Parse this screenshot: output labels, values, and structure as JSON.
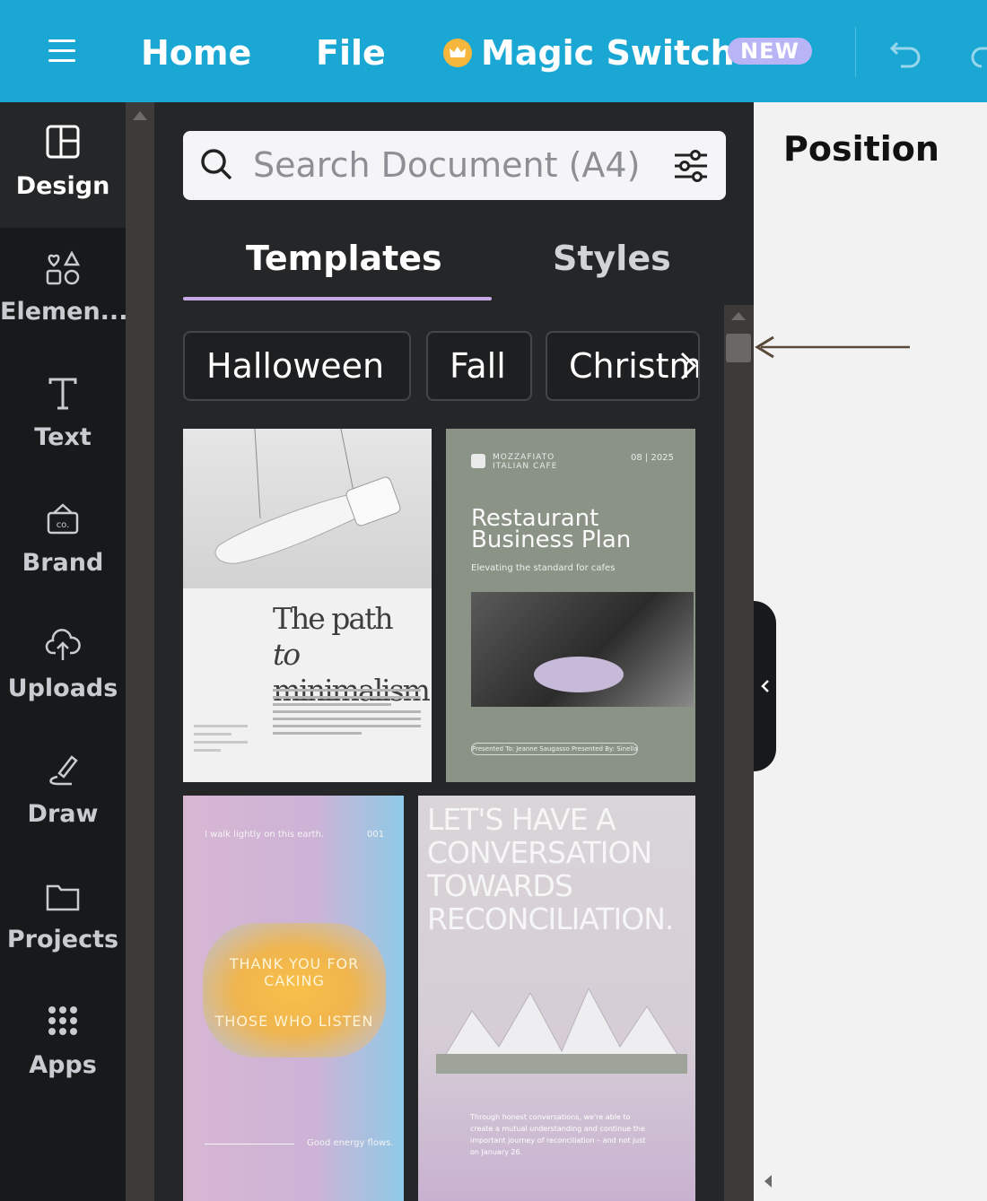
{
  "topbar": {
    "home": "Home",
    "file": "File",
    "magic_switch": "Magic Switch",
    "new_badge": "NEW"
  },
  "sidebar": {
    "items": [
      {
        "label": "Design",
        "icon": "layout-icon"
      },
      {
        "label": "Elemen...",
        "icon": "elements-icon"
      },
      {
        "label": "Text",
        "icon": "text-icon"
      },
      {
        "label": "Brand",
        "icon": "brand-icon"
      },
      {
        "label": "Uploads",
        "icon": "upload-cloud-icon"
      },
      {
        "label": "Draw",
        "icon": "draw-icon"
      },
      {
        "label": "Projects",
        "icon": "folder-icon"
      },
      {
        "label": "Apps",
        "icon": "apps-grid-icon"
      }
    ]
  },
  "panel": {
    "search_placeholder": "Search Document (A4)",
    "tabs": [
      "Templates",
      "Styles"
    ],
    "chips": [
      "Halloween",
      "Fall",
      "Christm"
    ]
  },
  "templates": {
    "t1": {
      "title_a": "The path ",
      "title_b": "to",
      "title_c": "minimalism"
    },
    "t2": {
      "brand": "MOZZAFIATO\nITALIAN CAFE",
      "date": "08 | 2025",
      "title": "Restaurant\nBusiness Plan",
      "subtitle": "Elevating the standard for cafes",
      "footer": "Presented To: Jeanne Saugasso    Presented By: Sinella Santoria"
    },
    "t3": {
      "top": "I walk lightly on this earth.",
      "num": "001",
      "line1": "THANK YOU FOR CAKING",
      "line2": "THOSE WHO LISTEN",
      "bottom": "Good energy flows."
    },
    "t4": {
      "heading": "LET'S HAVE A\nCONVERSATION\nTOWARDS\nRECONCILIATION.",
      "desc": "Through honest conversations, we're able to create a mutual understanding and continue the important journey of reconciliation – and not just on January 26."
    }
  },
  "right": {
    "position_label": "Position"
  },
  "colors": {
    "topbar": "#1aa7d4",
    "rail": "#18191b",
    "panel": "#252627",
    "tab_underline": "#c5a8e6",
    "new_badge": "#b8b4f5"
  }
}
